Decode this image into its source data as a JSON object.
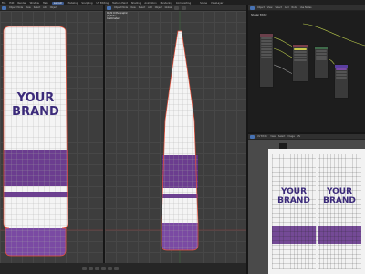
{
  "topbar": {
    "menus": [
      "File",
      "Edit",
      "Render",
      "Window",
      "Help"
    ],
    "workspaces": [
      "Layout",
      "Modeling",
      "Sculpting",
      "UV Editing",
      "Texture Paint",
      "Shading",
      "Animation",
      "Rendering",
      "Compositing"
    ],
    "active_workspace": "Layout",
    "scene": "Scene",
    "view_layer": "ViewLayer"
  },
  "viewport_left": {
    "header_items": [
      "Object Mode",
      "View",
      "Select",
      "Add",
      "Object"
    ]
  },
  "viewport_mid": {
    "header_items": [
      "Object Mode",
      "View",
      "Select",
      "Add",
      "Object",
      "Global"
    ],
    "overlay_lines": [
      "Right Orthographic",
      "(1) Tube",
      "Centimeters"
    ]
  },
  "node_editor": {
    "header_items": [
      "Object",
      "View",
      "Select",
      "Add",
      "Node",
      "Use Nodes"
    ],
    "title": "Shader Editor"
  },
  "uv_editor": {
    "header_items": [
      "UV Editor",
      "View",
      "Select",
      "Image",
      "UV"
    ]
  },
  "tube": {
    "brand_line1": "YOUR",
    "brand_line2": "BRAND",
    "purple": "#5e2d86",
    "cap": "#7a4aa3",
    "body": "#f4f4f4",
    "wire": "#9a9a9a",
    "outline": "#e8503a"
  },
  "colors": {
    "accent": "#4772b3",
    "node_link": "#b8c94a"
  }
}
